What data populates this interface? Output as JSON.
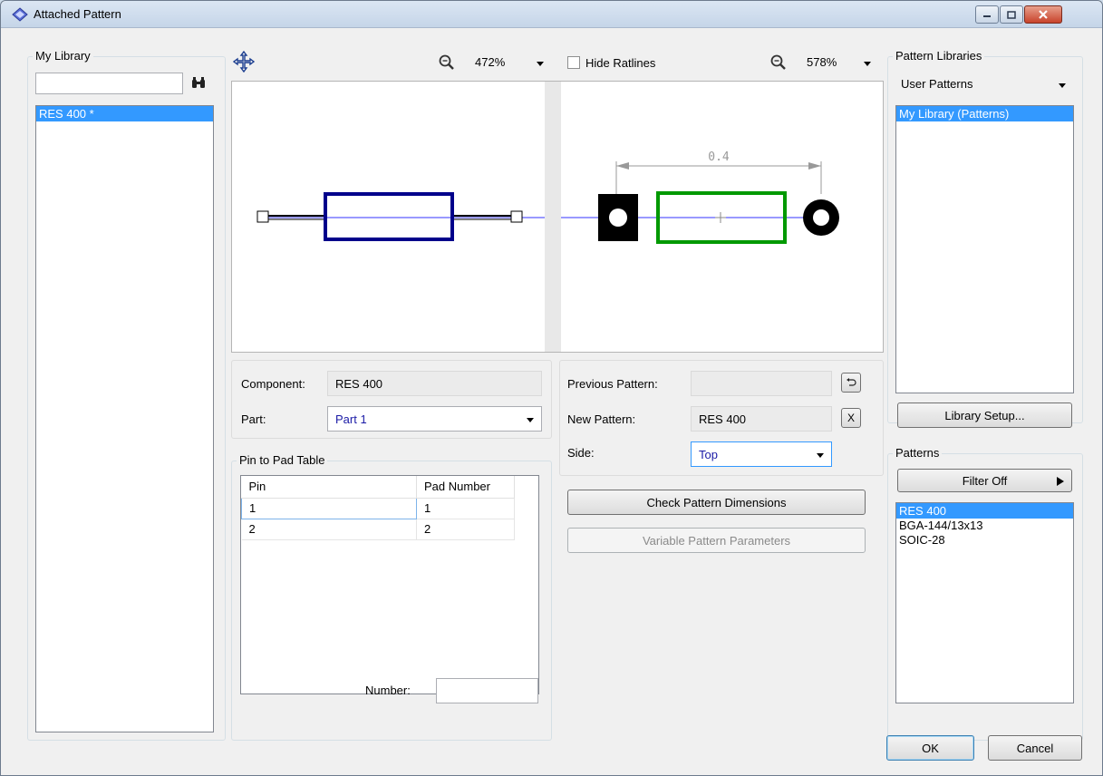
{
  "window": {
    "title": "Attached Pattern"
  },
  "my_library": {
    "label": "My Library",
    "search_value": "",
    "items": [
      {
        "label": "RES 400 *",
        "selected": true
      }
    ]
  },
  "preview": {
    "left_zoom": "472%",
    "hide_ratlines_label": "Hide Ratlines",
    "hide_ratlines_checked": false,
    "right_zoom": "578%",
    "dimension_label": "0.4"
  },
  "component": {
    "component_label": "Component:",
    "component_value": "RES 400",
    "part_label": "Part:",
    "part_value": "Part 1"
  },
  "pin_table": {
    "label": "Pin to Pad Table",
    "columns": [
      "Pin",
      "Pad Number"
    ],
    "rows": [
      [
        "1",
        "1"
      ],
      [
        "2",
        "2"
      ]
    ],
    "number_label": "Number:",
    "number_value": ""
  },
  "pattern_info": {
    "previous_label": "Previous Pattern:",
    "previous_value": "",
    "new_label": "New Pattern:",
    "new_value": "RES 400",
    "side_label": "Side:",
    "side_value": "Top",
    "clear_label": "X",
    "check_button": "Check Pattern Dimensions",
    "variable_button": "Variable Pattern Parameters"
  },
  "pattern_libraries": {
    "label": "Pattern Libraries",
    "selected": "User Patterns",
    "items": [
      {
        "label": "My Library (Patterns)",
        "selected": true
      }
    ],
    "setup_button": "Library Setup..."
  },
  "patterns": {
    "label": "Patterns",
    "filter_button": "Filter Off",
    "items": [
      {
        "label": "RES 400",
        "selected": true
      },
      {
        "label": "BGA-144/13x13",
        "selected": false
      },
      {
        "label": "SOIC-28",
        "selected": false
      }
    ]
  },
  "footer": {
    "ok": "OK",
    "cancel": "Cancel"
  },
  "colors": {
    "schematic_body": "#00008b",
    "pattern_body": "#009900",
    "ratline": "#0000ff",
    "selection": "#3399ff"
  }
}
